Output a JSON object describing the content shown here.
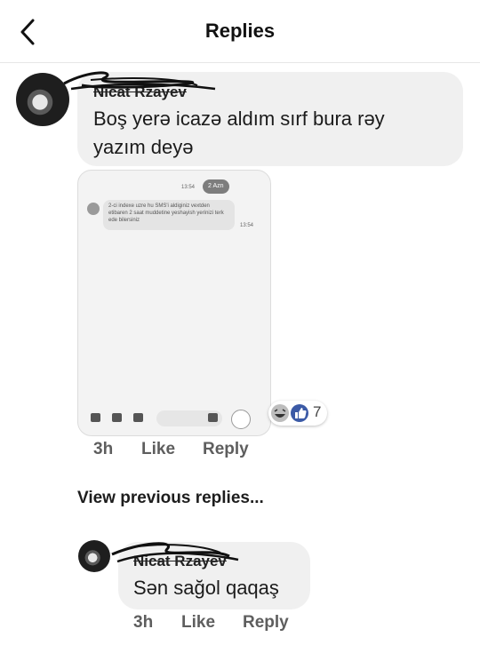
{
  "header": {
    "title": "Replies",
    "back_icon": "chevron-left-icon"
  },
  "comments": [
    {
      "author": "Nicat Rzayev",
      "text_lines": [
        "Boş yerə icazə aldım sırf bura rəy",
        "yazım deyə"
      ],
      "time": "3h",
      "like_label": "Like",
      "reply_label": "Reply",
      "attachment": {
        "top_badge": "2 Azn",
        "top_time": "13:54",
        "sms_text": "2-ci indexe uzre hu SMS'i aldiginiz vextden etibaren 2 saat muddetine yeshayish yerinizi terk ede bilersiniz",
        "sms_time": "13:54"
      },
      "reactions": {
        "icons": [
          "haha-icon",
          "like-icon"
        ],
        "count": "7"
      }
    },
    {
      "author": "Nicat Rzayev",
      "text": "Sən sağol qaqaş",
      "time": "3h",
      "like_label": "Like",
      "reply_label": "Reply"
    }
  ],
  "view_previous": "View previous replies...",
  "colors": {
    "bubble": "#f0f0f0",
    "action_text": "#5e5e5e",
    "react_blue": "#3b5aa6"
  }
}
